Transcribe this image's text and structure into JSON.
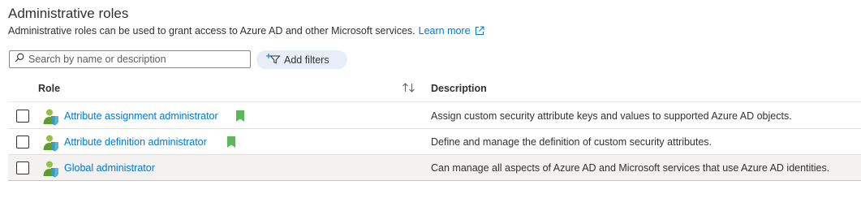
{
  "header": {
    "title": "Administrative roles",
    "subtitle": "Administrative roles can be used to grant access to Azure AD and other Microsoft services.",
    "learn_more": "Learn more"
  },
  "toolbar": {
    "search_placeholder": "Search by name or description",
    "add_filters_label": "Add filters"
  },
  "table": {
    "columns": {
      "role": "Role",
      "description": "Description"
    },
    "rows": [
      {
        "role": "Attribute assignment administrator",
        "description": "Assign custom security attribute keys and values to supported Azure AD objects.",
        "bookmarked": true,
        "selected": false
      },
      {
        "role": "Attribute definition administrator",
        "description": "Define and manage the definition of custom security attributes.",
        "bookmarked": true,
        "selected": false
      },
      {
        "role": "Global administrator",
        "description": "Can manage all aspects of Azure AD and Microsoft services that use Azure AD identities.",
        "bookmarked": false,
        "selected": true
      }
    ]
  },
  "icons": {
    "role": "admin-role-icon",
    "bookmark": "bookmark-icon",
    "search": "search-icon",
    "filter": "add-filter-icon",
    "external_link": "external-link-icon",
    "sort": "sort-icon"
  },
  "colors": {
    "link": "#0078d4",
    "bookmark": "#5cb85c",
    "filter_pill": "#e7eef8",
    "selected_row": "#f3f2f1"
  }
}
